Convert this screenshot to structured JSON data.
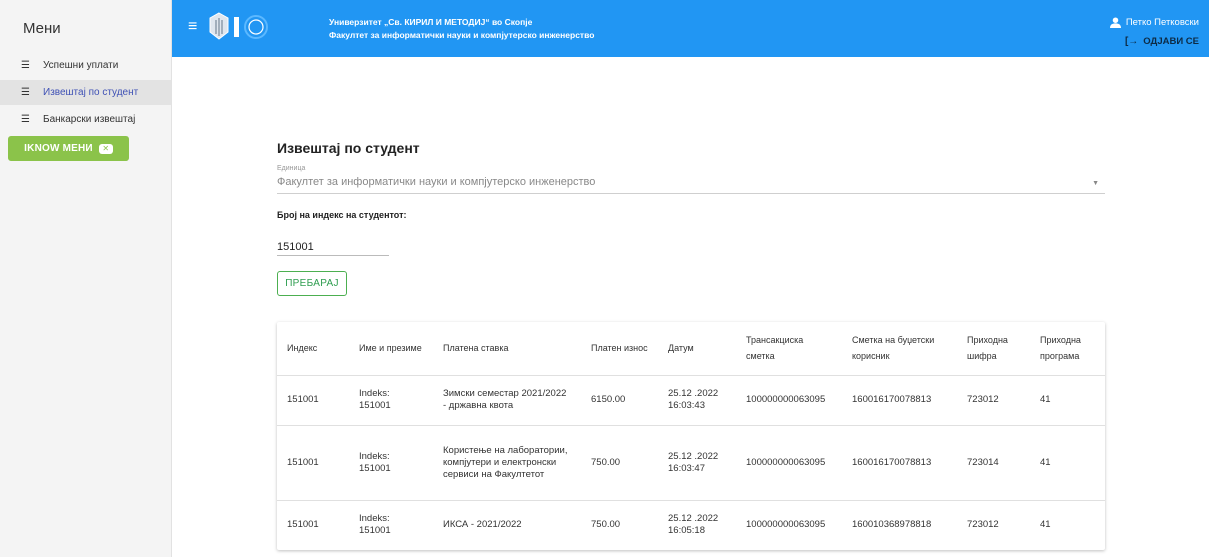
{
  "sidebar": {
    "title": "Мени",
    "items": [
      {
        "label": "Успешни уплати",
        "icon": "list-icon",
        "active": false
      },
      {
        "label": "Извештај по студент",
        "icon": "list-icon",
        "active": true
      },
      {
        "label": "Банкарски извештај",
        "icon": "list-icon",
        "active": false
      }
    ],
    "iknow_button": "IKNOW МЕНИ",
    "colors": {
      "active_text": "#3f51b5",
      "iknow_bg": "#8bc34a"
    }
  },
  "header": {
    "university": "Универзитет „Св. КИРИЛ И МЕТОДИЈ“ во Скопје",
    "faculty": "Факултет за информатички науки и компјутерско инженерство",
    "user_name": "Петко Петковски",
    "logout_label": "ОДЈАВИ СЕ",
    "bg_color": "#2196f3"
  },
  "main": {
    "title": "Извештај по студент",
    "unit_label": "Единица",
    "unit_value": "Факултет за информатички науки и компјутерско инженерство",
    "index_label": "Број на индекс на студентот:",
    "index_value": "151001",
    "search_button": "ПРЕБАРАЈ",
    "table": {
      "headers": [
        "Индекс",
        "Име и презиме",
        "Платена ставка",
        "Платен износ",
        "Датум",
        "Трансакциска сметка",
        "Сметка на буџетски корисник",
        "Приходна шифра",
        "Приходна програма"
      ],
      "rows": [
        [
          "151001",
          "Indeks: 151001",
          "Зимски семестар 2021/2022 - државна квота",
          "6150.00",
          "25.12 .2022 16:03:43",
          "100000000063095",
          "160016170078813",
          "723012",
          "41"
        ],
        [
          "151001",
          "Indeks: 151001",
          "Користење на лаборатории, компјутери и електронски сервиси на Факултетот",
          "750.00",
          "25.12 .2022 16:03:47",
          "100000000063095",
          "160016170078813",
          "723014",
          "41"
        ],
        [
          "151001",
          "Indeks: 151001",
          "ИКСА - 2021/2022",
          "750.00",
          "25.12 .2022 16:05:18",
          "100000000063095",
          "160010368978818",
          "723012",
          "41"
        ]
      ]
    }
  }
}
